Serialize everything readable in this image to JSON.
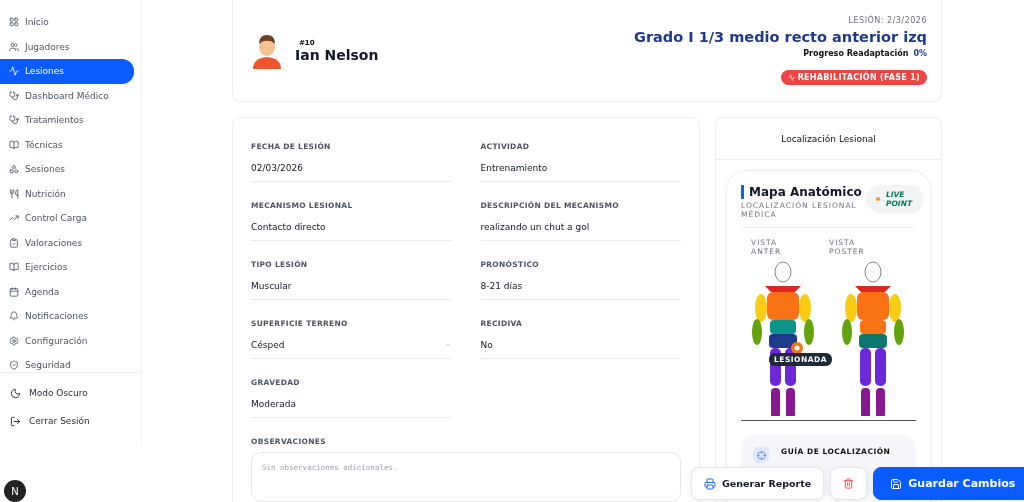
{
  "sidebar": {
    "items": [
      {
        "label": "Inicio",
        "selected": false
      },
      {
        "label": "Jugadores",
        "selected": false
      },
      {
        "label": "Lesiones",
        "selected": true
      },
      {
        "label": "Dashboard Médico",
        "selected": false
      },
      {
        "label": "Tratamientos",
        "selected": false
      },
      {
        "label": "Técnicas",
        "selected": false
      },
      {
        "label": "Sesiones",
        "selected": false
      },
      {
        "label": "Nutrición",
        "selected": false
      },
      {
        "label": "Control Carga",
        "selected": false
      },
      {
        "label": "Valoraciones",
        "selected": false
      },
      {
        "label": "Ejercicios",
        "selected": false
      },
      {
        "label": "Agenda",
        "selected": false
      },
      {
        "label": "Notificaciones",
        "selected": false
      },
      {
        "label": "Configuración",
        "selected": false
      },
      {
        "label": "Seguridad",
        "selected": false
      }
    ],
    "footer": [
      "Modo Oscuro",
      "Cerrar Sesión"
    ],
    "user_initial": "N"
  },
  "player": {
    "number": "#10",
    "name": "Ian Nelson",
    "injury_date": "LESIÓN: 2/3/2026",
    "diagnosis": "Grado I 1/3 medio recto anterior izq",
    "progress_label": "Progreso Readaptación",
    "progress_value": "0%",
    "status": "REHABILITACIÓN (FASE 1)"
  },
  "form": {
    "fields": [
      {
        "label": "FECHA DE LESIÓN",
        "value": "02/03/2026",
        "kind": "text"
      },
      {
        "label": "ACTIVIDAD",
        "value": "Entrenamiento",
        "kind": "text"
      },
      {
        "label": "MECANISMO LESIONAL",
        "value": "Contacto directo",
        "kind": "text"
      },
      {
        "label": "DESCRIPCIÓN DEL MECANISMO",
        "value": "realizando un chut a gol",
        "kind": "text"
      },
      {
        "label": "TIPO LESIÓN",
        "value": "Muscular",
        "kind": "text"
      },
      {
        "label": "PRONÓSTICO",
        "value": "8-21 días",
        "kind": "text"
      },
      {
        "label": "SUPERFICIE TERRENO",
        "value": "Césped",
        "kind": "select"
      },
      {
        "label": "RECIDIVA",
        "value": "No",
        "kind": "text"
      },
      {
        "label": "GRAVEDAD",
        "value": "Moderada",
        "kind": "text"
      }
    ],
    "notes": {
      "label": "OBSERVACIONES",
      "placeholder": "Sin observaciones adicionales."
    }
  },
  "location": {
    "title": "Localización Lesional",
    "map_title": "Mapa Anatómico",
    "map_subtitle": "LOCALIZACIÓN LESIONAL MÉDICA",
    "live_badge": "LIVE POINT",
    "front_label": [
      "VISTA",
      "ANTER"
    ],
    "back_label": [
      "VISTA",
      "POSTER"
    ],
    "marker_label": "LESIONADA",
    "guide_title": "GUÍA DE LOCALIZACIÓN"
  },
  "actions": [
    "Generar Reporte",
    "Guardar Cambios"
  ]
}
